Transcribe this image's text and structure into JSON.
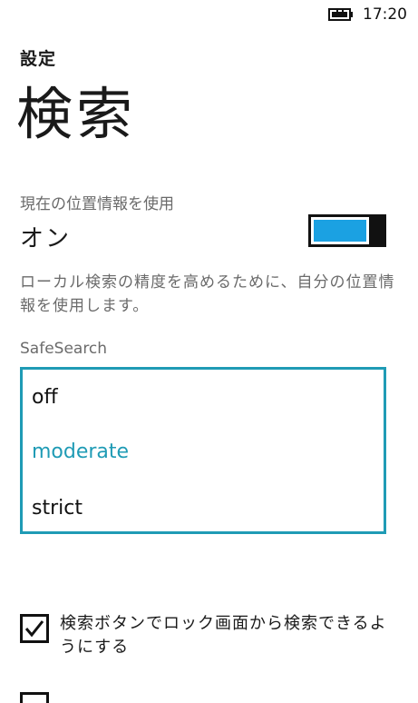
{
  "status_bar": {
    "time": "17:20",
    "battery_icon": "battery-charging-icon"
  },
  "header": {
    "app_title": "設定",
    "page_title": "検索"
  },
  "location": {
    "label": "現在の位置情報を使用",
    "value": "オン",
    "toggle_on": true,
    "accent_color": "#1ba1e2",
    "description": "ローカル検索の精度を高めるために、自分の位置情報を使用します。"
  },
  "safesearch": {
    "label": "SafeSearch",
    "options": [
      "off",
      "moderate",
      "strict"
    ],
    "selected": "moderate",
    "accent_color": "#1f9bb5"
  },
  "lock_screen_search": {
    "label": "検索ボタンでロック画面から検索できるようにする",
    "checked": true
  }
}
